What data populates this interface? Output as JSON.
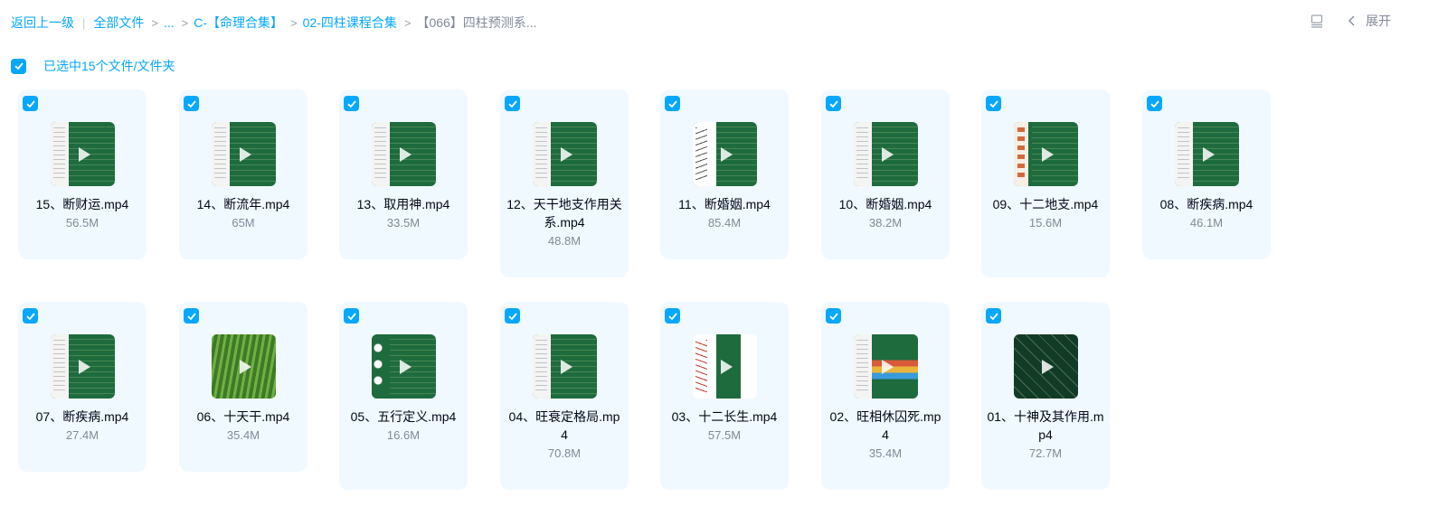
{
  "breadcrumb": {
    "back": "返回上一级",
    "items": [
      "全部文件",
      "...",
      "C-【命理合集】",
      "02-四柱课程合集",
      "【066】四柱预测系..."
    ]
  },
  "toolbar": {
    "expand_label": "展开"
  },
  "selection": {
    "text": "已选中15个文件/文件夹"
  },
  "files": [
    {
      "name": "15、断财运.mp4",
      "size": "56.5M",
      "thumb": "board"
    },
    {
      "name": "14、断流年.mp4",
      "size": "65M",
      "thumb": "board"
    },
    {
      "name": "13、取用神.mp4",
      "size": "33.5M",
      "thumb": "board"
    },
    {
      "name": "12、天干地支作用关系.mp4",
      "size": "48.8M",
      "thumb": "board"
    },
    {
      "name": "11、断婚姻.mp4",
      "size": "85.4M",
      "thumb": "hand"
    },
    {
      "name": "10、断婚姻.mp4",
      "size": "38.2M",
      "thumb": "board"
    },
    {
      "name": "09、十二地支.mp4",
      "size": "15.6M",
      "thumb": "faces"
    },
    {
      "name": "08、断疾病.mp4",
      "size": "46.1M",
      "thumb": "board"
    },
    {
      "name": "07、断疾病.mp4",
      "size": "27.4M",
      "thumb": "board"
    },
    {
      "name": "06、十天干.mp4",
      "size": "35.4M",
      "thumb": "grass"
    },
    {
      "name": "05、五行定义.mp4",
      "size": "16.6M",
      "thumb": "circles"
    },
    {
      "name": "04、旺衰定格局.mp4",
      "size": "70.8M",
      "thumb": "board"
    },
    {
      "name": "03、十二长生.mp4",
      "size": "57.5M",
      "thumb": "hands2"
    },
    {
      "name": "02、旺相休囚死.mp4",
      "size": "35.4M",
      "thumb": "color"
    },
    {
      "name": "01、十神及其作用.mp4",
      "size": "72.7M",
      "thumb": "chart"
    }
  ]
}
